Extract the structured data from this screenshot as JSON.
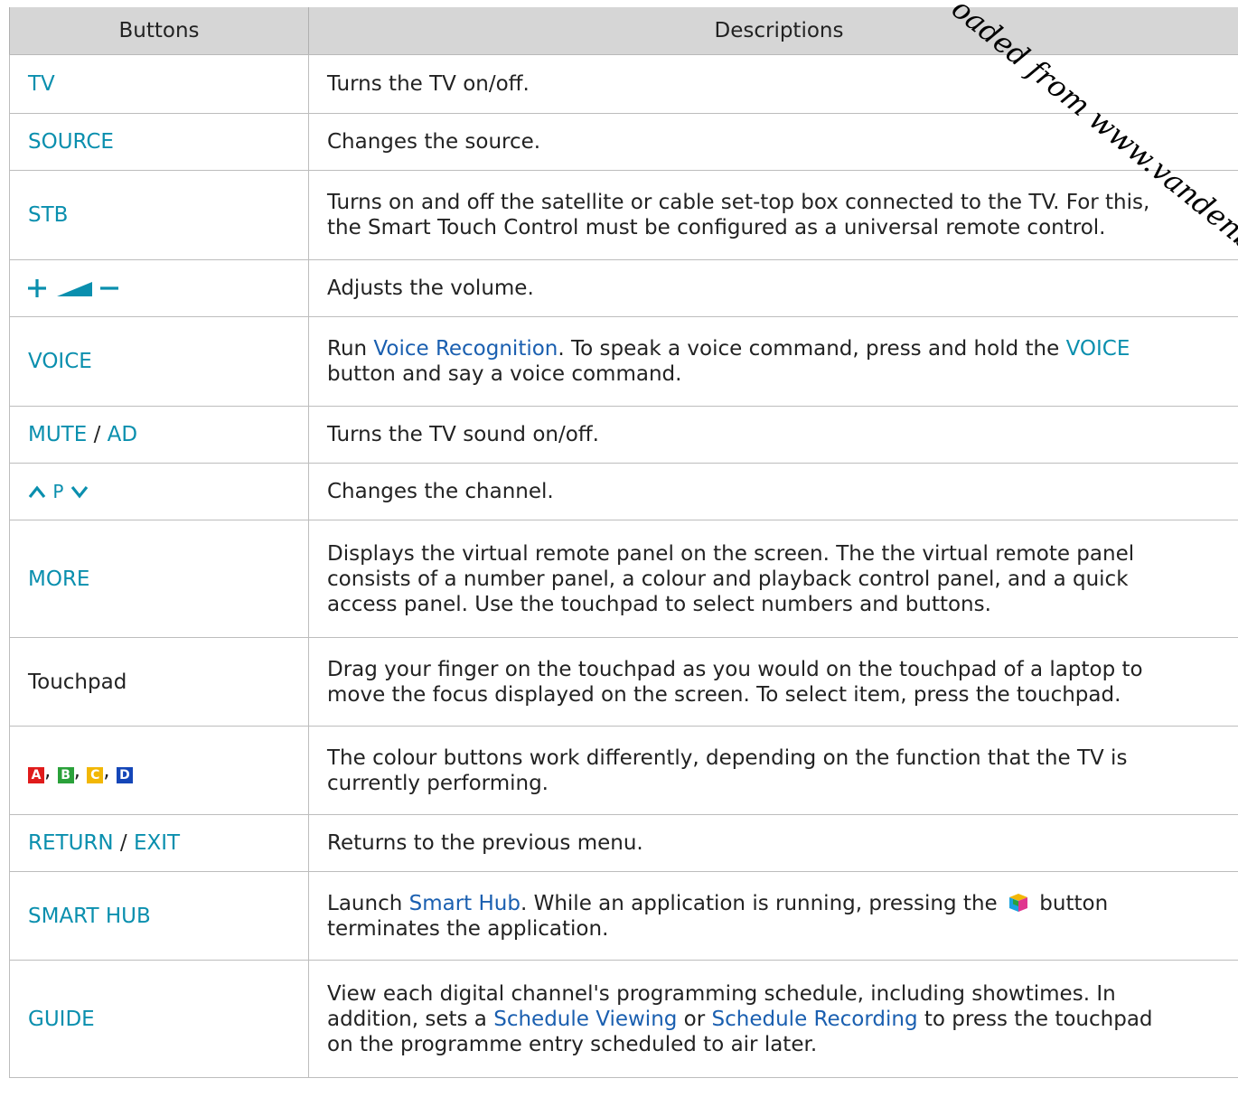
{
  "header": {
    "col1": "Buttons",
    "col2": "Descriptions"
  },
  "rows": [
    {
      "button": "TV",
      "desc": "Turns the TV on/off."
    },
    {
      "button": "SOURCE",
      "desc": "Changes the source."
    },
    {
      "button": "STB",
      "desc_l1": "Turns on and off the satellite or cable set-top box connected to the TV. For this,",
      "desc_l2": "the Smart Touch Control must be configured as a universal remote control."
    },
    {
      "desc": "Adjusts the volume."
    },
    {
      "button": "VOICE",
      "desc_a": "Run ",
      "link": "Voice Recognition",
      "desc_b": ". To speak a voice command, press and hold the ",
      "btn": "VOICE",
      "desc_l2": "button and say a voice command."
    },
    {
      "button_a": "MUTE",
      "sep": " / ",
      "button_b": "AD",
      "desc": "Turns the TV sound on/off."
    },
    {
      "button": "P",
      "desc": "Changes the channel."
    },
    {
      "button": "MORE",
      "desc_l1": "Displays the virtual remote panel on the screen. The the virtual remote panel",
      "desc_l2": "consists of a number panel, a colour and playback control panel, and a quick",
      "desc_l3": "access panel. Use the touchpad to select numbers and buttons."
    },
    {
      "button": "Touchpad",
      "desc_l1": "Drag your finger on the touchpad as you would on the touchpad of a laptop to",
      "desc_l2": "move the focus displayed on the screen. To select item, press the touchpad."
    },
    {
      "keys": [
        "A",
        "B",
        "C",
        "D"
      ],
      "key_colors": [
        "#e01b1b",
        "#2aa13a",
        "#f2b705",
        "#1446b8"
      ],
      "desc_l1": "The colour buttons work differently, depending on the function that the TV is",
      "desc_l2": "currently performing."
    },
    {
      "button_a": "RETURN",
      "sep": " / ",
      "button_b": "EXIT",
      "desc": "Returns to the previous menu."
    },
    {
      "button": "SMART HUB",
      "desc_a": "Launch ",
      "link": "Smart Hub",
      "desc_b": ". While an application is running, pressing the",
      "desc_c": "button",
      "desc_l2": "terminates the application."
    },
    {
      "button": "GUIDE",
      "desc_l1": "View each digital channel's programming schedule, including showtimes. In",
      "l2_a": "addition, sets a ",
      "link1": "Schedule Viewing",
      "l2_b": " or ",
      "link2": "Schedule Recording",
      "l2_c": " to press the touchpad",
      "desc_l3": "on the programme entry scheduled to air later."
    }
  ],
  "watermark": "oaded from www.vandenb",
  "colors": {
    "button_text": "#0a8fae",
    "link_text": "#1a5fb0",
    "header_bg": "#d6d6d6"
  }
}
